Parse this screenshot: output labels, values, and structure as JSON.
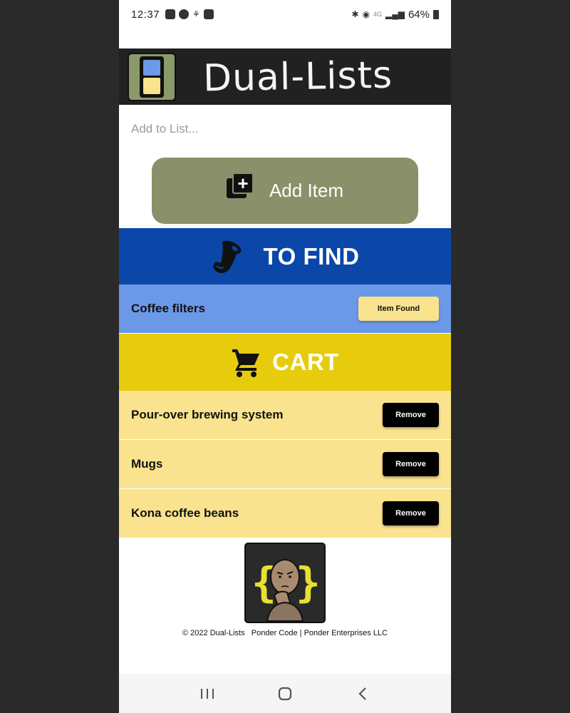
{
  "status": {
    "time": "12:37",
    "battery": "64%",
    "network": "4G"
  },
  "header": {
    "title": "Dual-Lists"
  },
  "add": {
    "placeholder": "Add to List...",
    "button_label": "Add Item"
  },
  "find": {
    "title": "TO FIND",
    "items": [
      {
        "label": "Coffee filters",
        "action": "Item Found"
      }
    ]
  },
  "cart": {
    "title": "CART",
    "items": [
      {
        "label": "Pour-over brewing system",
        "action": "Remove"
      },
      {
        "label": "Mugs",
        "action": "Remove"
      },
      {
        "label": "Kona coffee beans",
        "action": "Remove"
      }
    ]
  },
  "footer": {
    "copyright": "© 2022 Dual-Lists   Ponder Code | Ponder Enterprises LLC"
  },
  "colors": {
    "header_bg": "#212121",
    "add_button": "#8a916a",
    "find_header": "#0a47a8",
    "find_row": "#6c98e8",
    "cart_header": "#e6cc0c",
    "cart_row": "#f9e38e",
    "found_button": "#f9e38e",
    "remove_button": "#000000"
  }
}
